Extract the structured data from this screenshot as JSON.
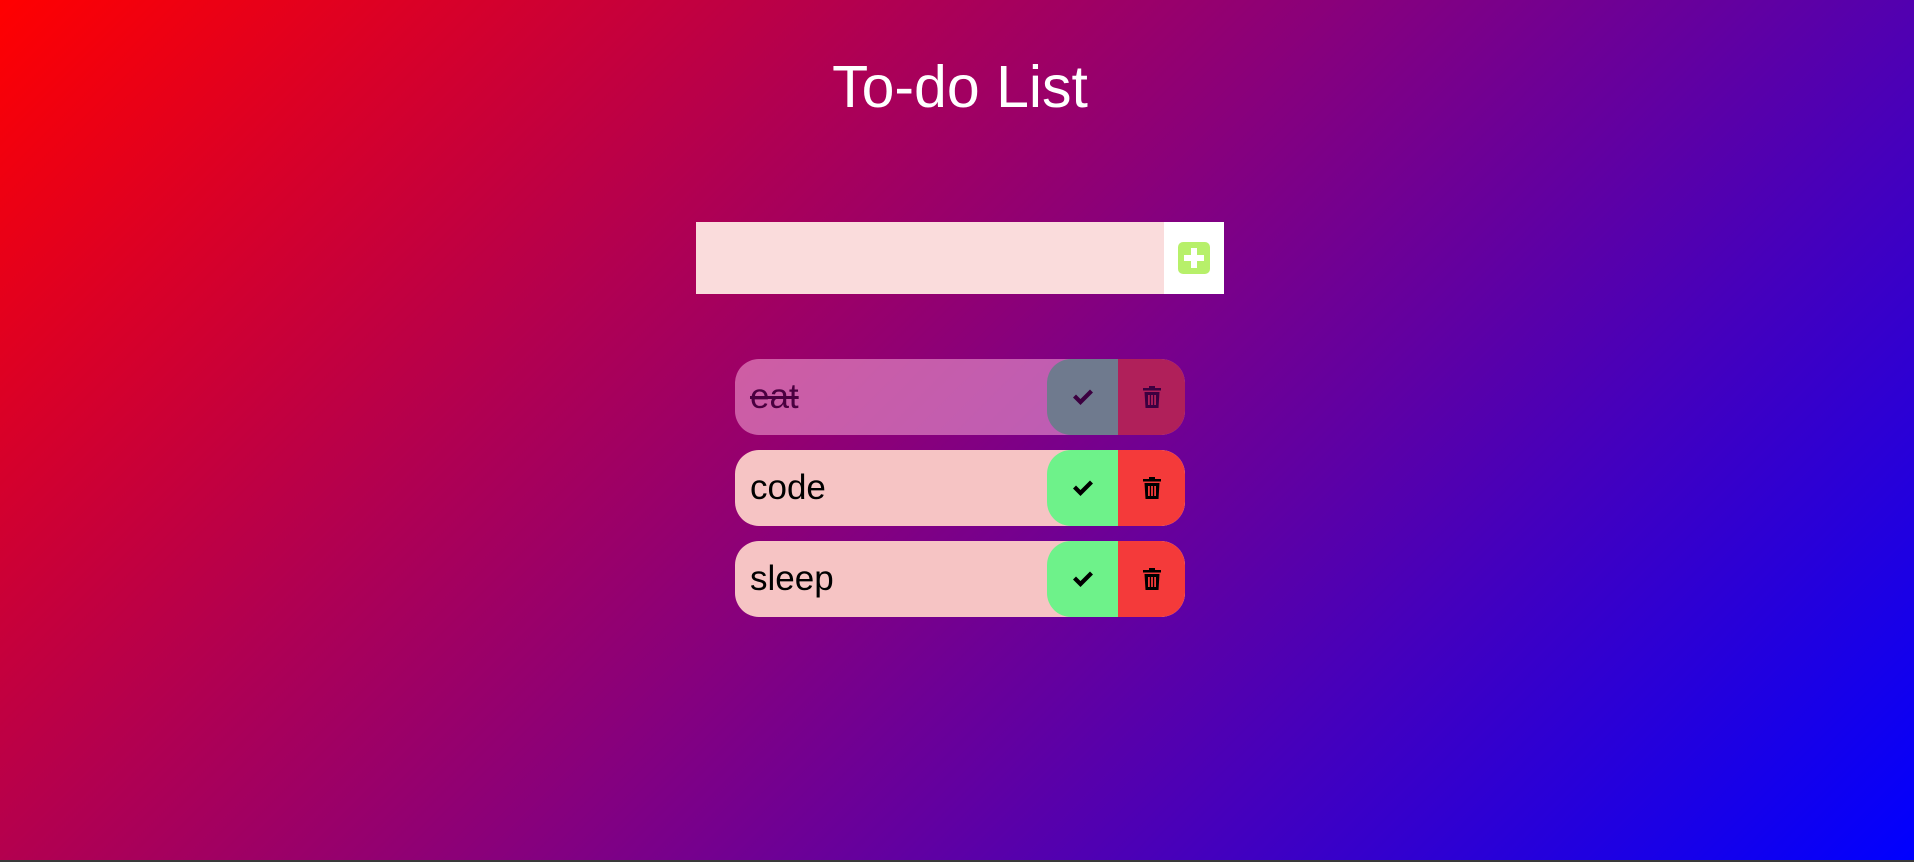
{
  "header": {
    "title": "To-do List"
  },
  "add_form": {
    "input_value": "",
    "input_placeholder": "",
    "add_icon": "plus-square-icon"
  },
  "todos": [
    {
      "text": "eat",
      "completed": true
    },
    {
      "text": "code",
      "completed": false
    },
    {
      "text": "sleep",
      "completed": false
    }
  ],
  "icons": {
    "check": "check-icon",
    "delete": "trash-icon"
  },
  "colors": {
    "gradient_start": "#ff0000",
    "gradient_mid": "#8a007a",
    "gradient_end": "#0000ff",
    "input_bg": "#fadcdc",
    "add_icon": "#b7f06a",
    "item_bg": "#f6c4c4",
    "check_bg": "#6ef28a",
    "trash_bg": "#f43a3a"
  }
}
